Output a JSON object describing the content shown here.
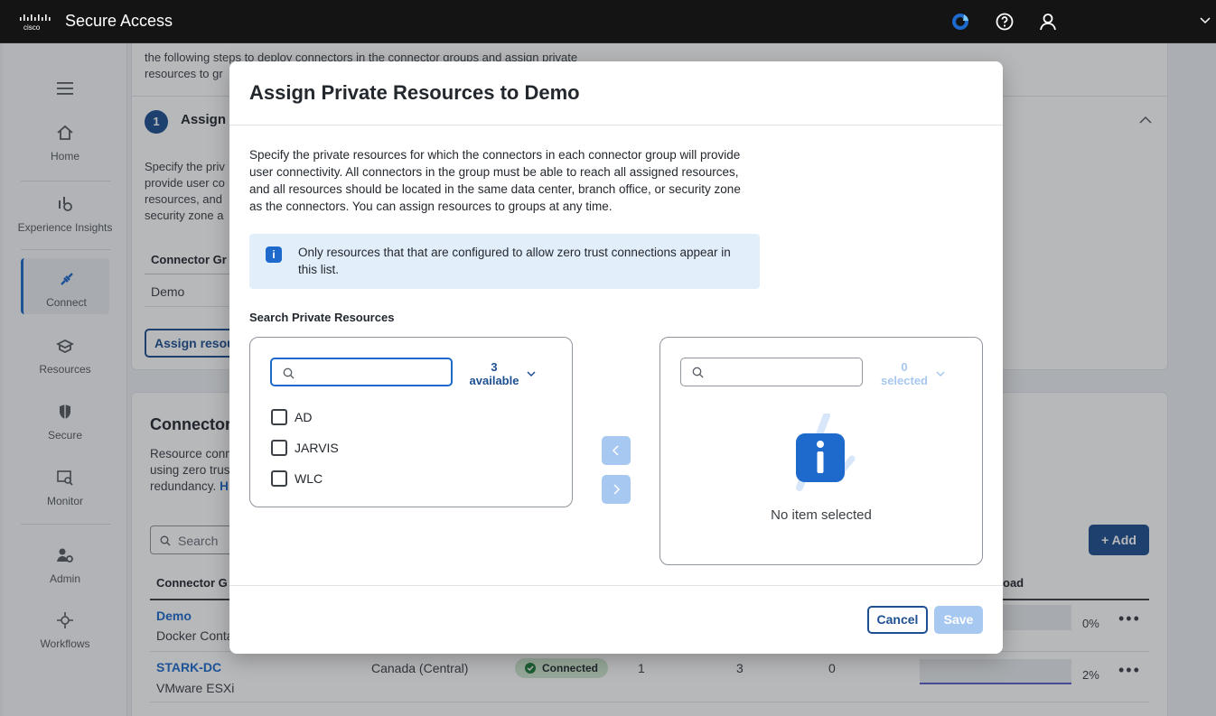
{
  "header": {
    "brand": "cisco",
    "app_title": "Secure Access",
    "icons": [
      "app-status-icon",
      "help-icon",
      "user-icon",
      "chevron-down-icon"
    ]
  },
  "sidebar": {
    "items": [
      {
        "label": "Home",
        "icon": "home-icon"
      },
      {
        "label": "Experience Insights",
        "icon": "insights-icon"
      },
      {
        "label": "Connect",
        "icon": "connect-icon"
      },
      {
        "label": "Resources",
        "icon": "resources-icon"
      },
      {
        "label": "Secure",
        "icon": "shield-icon"
      },
      {
        "label": "Monitor",
        "icon": "monitor-icon"
      },
      {
        "label": "Admin",
        "icon": "admin-icon"
      },
      {
        "label": "Workflows",
        "icon": "workflows-icon"
      }
    ],
    "active": "Connect"
  },
  "background": {
    "intro_line1": "the following steps to deploy connectors in the connector groups and assign private",
    "intro_line2": "resources to gr",
    "step_number": "1",
    "step_title": "Assign",
    "step_desc": [
      "Specify the priv",
      "provide user co",
      "resources, and",
      "security zone a"
    ],
    "table_header": "Connector Gr",
    "table_row": "Demo",
    "assign_button": "Assign resou",
    "section_title": "Connector",
    "section_desc": [
      "Resource conn",
      "using zero trus",
      "redundancy."
    ],
    "section_desc_link": "H",
    "search_placeholder": "Search",
    "add_button": "+ Add",
    "list_header_left": "Connector G",
    "list_header_right": "oad",
    "rows": [
      {
        "name": "Demo",
        "type": "Docker Conta",
        "load": "0%"
      },
      {
        "name": "STARK-DC",
        "type": "VMware ESXi",
        "region": "Canada (Central)",
        "status": "Connected",
        "c1": "1",
        "c2": "3",
        "c3": "0",
        "load": "2%"
      }
    ]
  },
  "modal": {
    "title": "Assign Private Resources to Demo",
    "description": "Specify the private resources for which the connectors in each connector group will provide user connectivity. All connectors in the group must be able to reach all assigned resources, and all resources should be located in the same data center, branch office, or security zone as the connectors. You can assign resources to groups at any time.",
    "info_text": "Only resources that that are configured to allow zero trust connections appear in this list.",
    "search_label": "Search Private Resources",
    "available": {
      "count": "3",
      "count_label": "available",
      "search_value": "",
      "items": [
        "AD",
        "JARVIS",
        "WLC"
      ]
    },
    "selected": {
      "count": "0",
      "count_label": "selected",
      "search_value": "",
      "empty_text": "No item selected"
    },
    "cancel_label": "Cancel",
    "save_label": "Save"
  },
  "colors": {
    "accent": "#1d69cc",
    "accent_dark": "#1d4f91",
    "disabled_blue": "#a7c8f0",
    "connected_green": "#cfe8cf"
  }
}
